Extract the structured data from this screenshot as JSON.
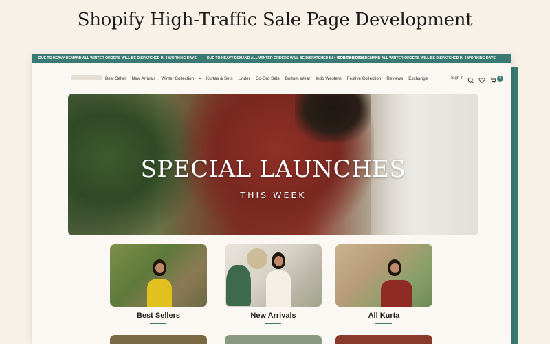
{
  "page": {
    "heading": "Shopify High-Traffic Sale Page Development"
  },
  "colors": {
    "accent": "#3b7a73",
    "background": "#f7f1e8",
    "hero_shirt": "#8b352b"
  },
  "ticker": {
    "message_1": "DUE TO HEAVY DEMAND ALL WINTER ORDERS WILL BE DISPATCHED IN 4 WORKING DAYS",
    "message_2": "DUE TO HEAVY DEMAND ALL WINTER ORDERS WILL BE DISPATCHED IN 4 WORKING DAYS",
    "message_3": "DUE TO HEAVY DEMAND ALL WINTER ORDERS WILL BE DISPATCHED IN 4 WORKING DAYS"
  },
  "nav": {
    "items": [
      {
        "label": "Best Seller"
      },
      {
        "label": "New Arrivals"
      },
      {
        "label": "Winter Collection"
      },
      {
        "label": "Kurtas & Sets"
      },
      {
        "label": "Under"
      },
      {
        "label": "Co-Ord Sets"
      },
      {
        "label": "Bottom Wear"
      },
      {
        "label": "Indo Western"
      },
      {
        "label": "Festive Collection"
      },
      {
        "label": "Reviews"
      },
      {
        "label": "Exchange"
      }
    ],
    "sign_in": "Sign in",
    "cart_count": "0",
    "icons": [
      "search-icon",
      "heart-icon",
      "cart-icon"
    ]
  },
  "hero": {
    "title": "SPECIAL LAUNCHES",
    "subtitle": "THIS WEEK"
  },
  "categories": [
    {
      "label": "Best Sellers",
      "outfit_color": "#e2c11f"
    },
    {
      "label": "New Arrivals",
      "outfit_color": "#f3efe6"
    },
    {
      "label": "All Kurta",
      "outfit_color": "#8f2a24"
    }
  ]
}
